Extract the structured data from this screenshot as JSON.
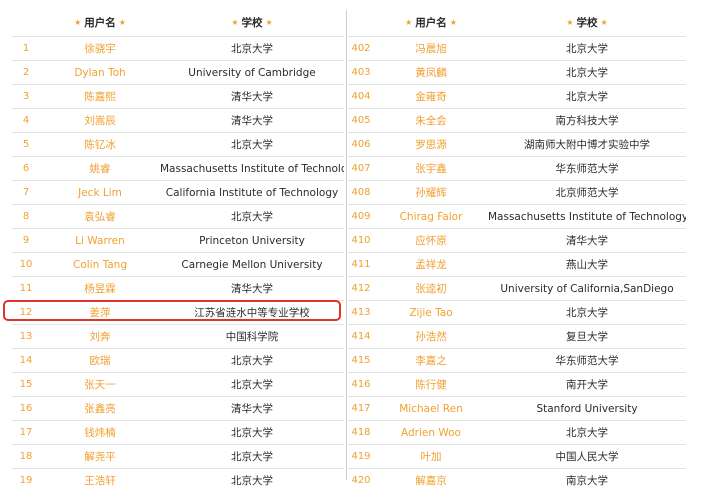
{
  "headers": {
    "name": "用户名",
    "school": "学校",
    "star": "★"
  },
  "left_rows": [
    {
      "no": "1",
      "name": "徐骁宇",
      "school": "北京大学"
    },
    {
      "no": "2",
      "name": "Dylan Toh",
      "school": "University of Cambridge"
    },
    {
      "no": "3",
      "name": "陈嘉熙",
      "school": "清华大学"
    },
    {
      "no": "4",
      "name": "刘嵩辰",
      "school": "清华大学"
    },
    {
      "no": "5",
      "name": "陈钇冰",
      "school": "北京大学"
    },
    {
      "no": "6",
      "name": "姚睿",
      "school": "Massachusetts Institute of Technology"
    },
    {
      "no": "7",
      "name": "Jeck Lim",
      "school": "California Institute of Technology"
    },
    {
      "no": "8",
      "name": "袁弘睿",
      "school": "北京大学"
    },
    {
      "no": "9",
      "name": "Li Warren",
      "school": "Princeton University"
    },
    {
      "no": "10",
      "name": "Colin Tang",
      "school": "Carnegie Mellon University"
    },
    {
      "no": "11",
      "name": "杨昱霖",
      "school": "清华大学"
    },
    {
      "no": "12",
      "name": "姜萍",
      "school": "江苏省涟水中等专业学校"
    },
    {
      "no": "13",
      "name": "刘奔",
      "school": "中国科学院"
    },
    {
      "no": "14",
      "name": "欧瑞",
      "school": "北京大学"
    },
    {
      "no": "15",
      "name": "张天一",
      "school": "北京大学"
    },
    {
      "no": "16",
      "name": "张鑫亮",
      "school": "清华大学"
    },
    {
      "no": "17",
      "name": "钱炜楠",
      "school": "北京大学"
    },
    {
      "no": "18",
      "name": "解尧平",
      "school": "北京大学"
    },
    {
      "no": "19",
      "name": "王浩轩",
      "school": "北京大学"
    }
  ],
  "right_rows": [
    {
      "no": "402",
      "name": "冯晨旭",
      "school": "北京大学"
    },
    {
      "no": "403",
      "name": "黄凤麟",
      "school": "北京大学"
    },
    {
      "no": "404",
      "name": "金雍奇",
      "school": "北京大学"
    },
    {
      "no": "405",
      "name": "朱全会",
      "school": "南方科技大学"
    },
    {
      "no": "406",
      "name": "罗思源",
      "school": "湖南师大附中博才实验中学"
    },
    {
      "no": "407",
      "name": "张宇鑫",
      "school": "华东师范大学"
    },
    {
      "no": "408",
      "name": "孙耀辉",
      "school": "北京师范大学"
    },
    {
      "no": "409",
      "name": "Chirag Falor",
      "school": "Massachusetts Institute of Technology"
    },
    {
      "no": "410",
      "name": "应怀原",
      "school": "清华大学"
    },
    {
      "no": "411",
      "name": "孟祥龙",
      "school": "燕山大学"
    },
    {
      "no": "412",
      "name": "张逵初",
      "school": "University of California,SanDiego"
    },
    {
      "no": "413",
      "name": "Zijie Tao",
      "school": "北京大学"
    },
    {
      "no": "414",
      "name": "孙浩然",
      "school": "复旦大学"
    },
    {
      "no": "415",
      "name": "李嘉之",
      "school": "华东师范大学"
    },
    {
      "no": "416",
      "name": "陈行健",
      "school": "南开大学"
    },
    {
      "no": "417",
      "name": "Michael Ren",
      "school": "Stanford University"
    },
    {
      "no": "418",
      "name": "Adrien Woo",
      "school": "北京大学"
    },
    {
      "no": "419",
      "name": "叶加",
      "school": "中国人民大学"
    },
    {
      "no": "420",
      "name": "解嘉京",
      "school": "南京大学"
    }
  ],
  "colors": {
    "accent": "#f0a030",
    "highlight": "#e0332b",
    "text": "#2b2b2b"
  }
}
